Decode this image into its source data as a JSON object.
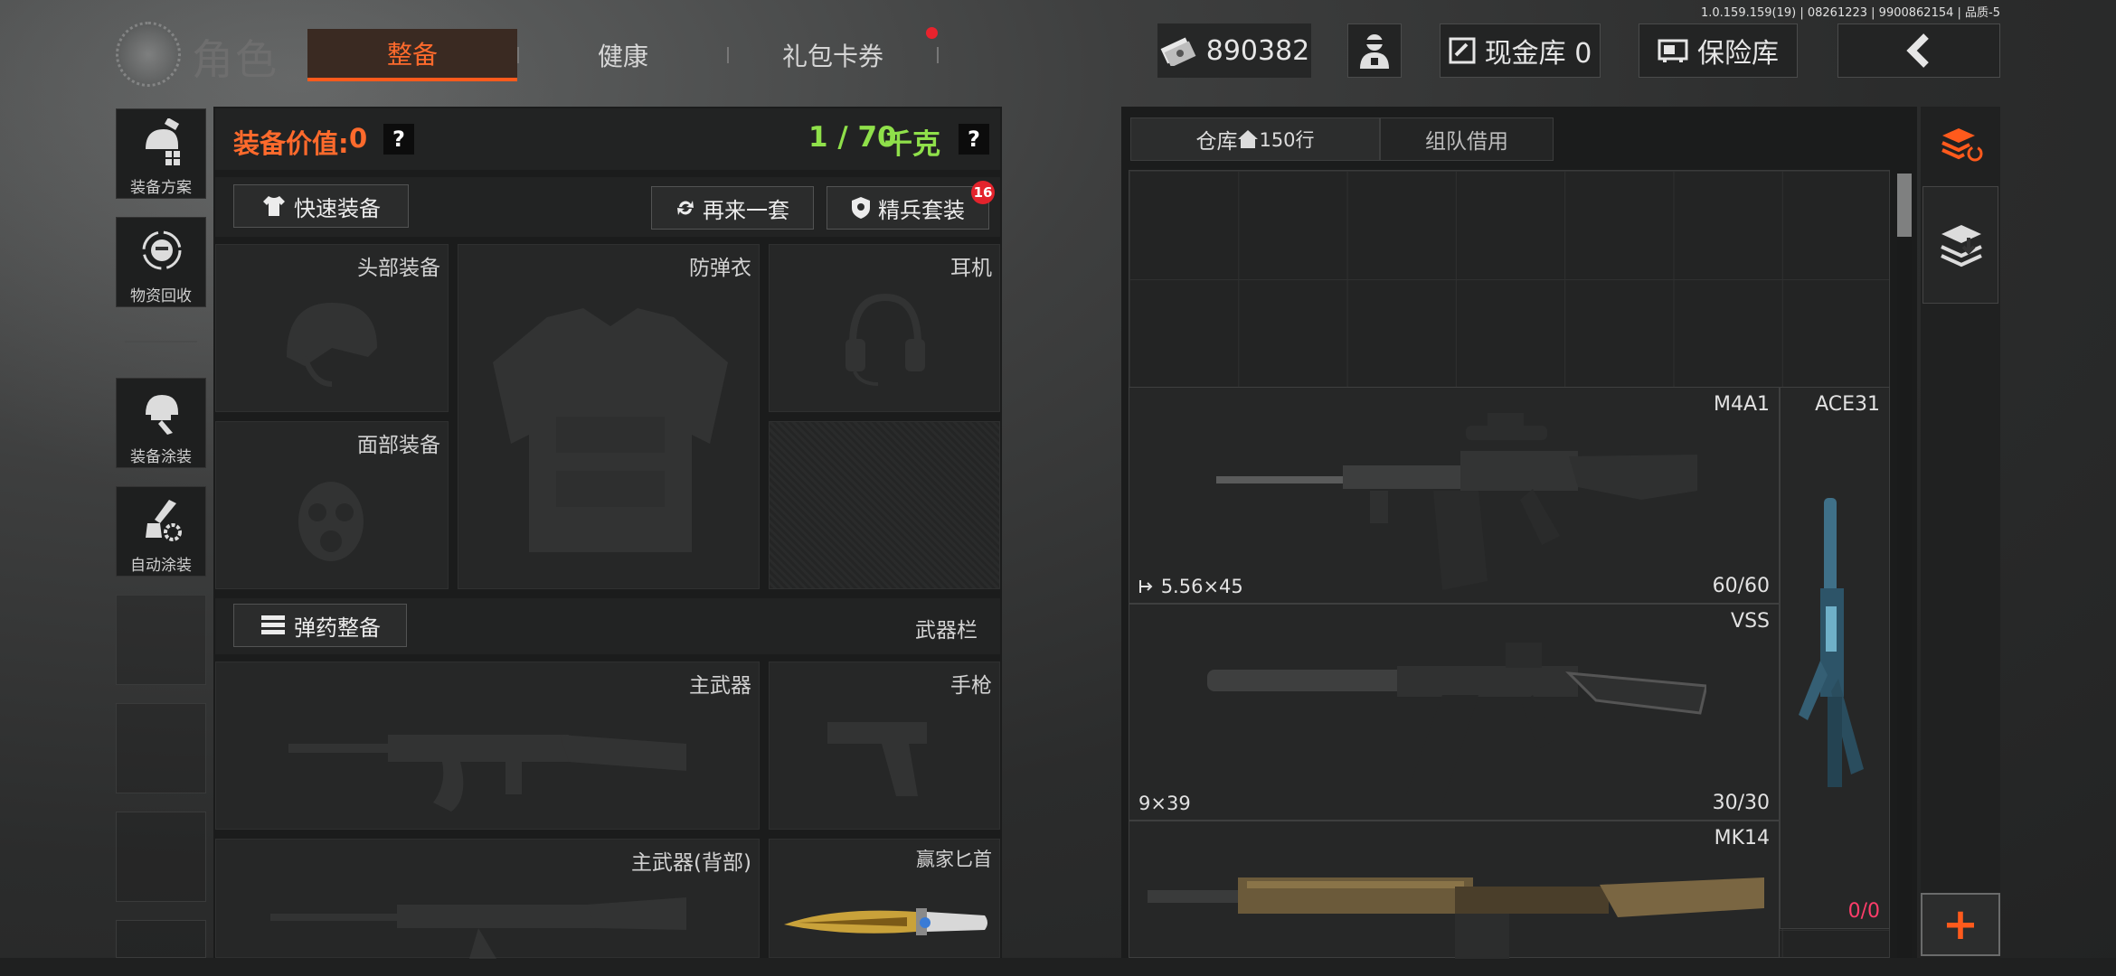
{
  "version": "1.0.159.159(19) | 08261223 | 9900862154 | 品质-5",
  "header": {
    "title": "角色",
    "tabs": [
      {
        "label": "整备",
        "active": true
      },
      {
        "label": "健康",
        "active": false
      },
      {
        "label": "礼包卡券",
        "active": false
      }
    ],
    "currency": "890382",
    "cash_vault": "现金库 0",
    "insurance_vault": "保险库"
  },
  "sidebar": {
    "items": [
      {
        "label": "装备方案",
        "icon": "helmet-wrench-icon"
      },
      {
        "label": "物资回收",
        "icon": "recycle-face-icon"
      },
      {
        "label": "装备涂装",
        "icon": "helmet-brush-icon"
      },
      {
        "label": "自动涂装",
        "icon": "brush-gear-icon"
      }
    ]
  },
  "equipment": {
    "value_label": "装备价值:",
    "value": "0",
    "weight": "1 / 70",
    "weight_unit": "千克",
    "help": "?",
    "quick_equip": "快速装备",
    "again": "再来一套",
    "elite_set": "精兵套装",
    "elite_badge": "16",
    "slots": {
      "head": "头部装备",
      "armor": "防弹衣",
      "headset": "耳机",
      "face": "面部装备"
    },
    "ammo_button": "弹药整备",
    "weapon_bar": "武器栏",
    "weapons": {
      "primary": "主武器",
      "pistol": "手枪",
      "primary_back": "主武器(背部)",
      "knife": "赢家匕首"
    }
  },
  "warehouse": {
    "tab_storage": "仓库",
    "rows": "150行",
    "tab_team": "组队借用",
    "items": [
      {
        "name": "M4A1",
        "caliber": "5.56×45",
        "count": "60/60"
      },
      {
        "name": "VSS",
        "caliber": "9×39",
        "count": "30/30"
      },
      {
        "name": "MK14",
        "caliber": "",
        "count": ""
      },
      {
        "name": "ACE31",
        "caliber": "",
        "count": "0/0"
      }
    ]
  },
  "colors": {
    "accent": "#ff5a1c",
    "weight": "#8fe04a",
    "badge": "#e3232c"
  }
}
